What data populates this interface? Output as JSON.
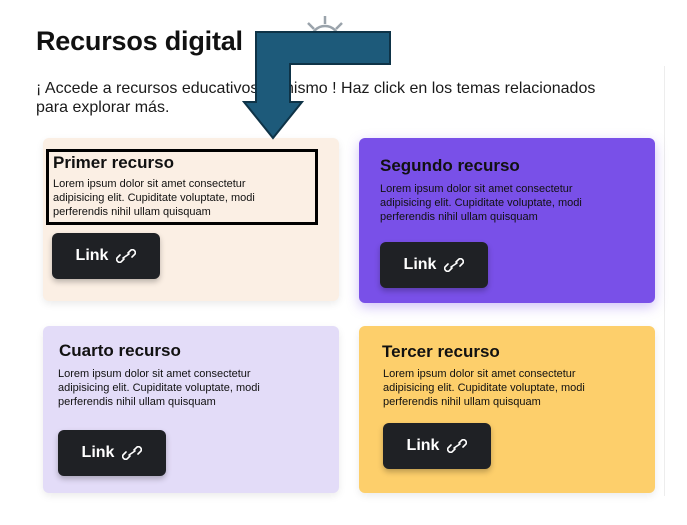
{
  "page": {
    "title": "Recursos digital",
    "intro": "¡ Accede a recursos educativos tú mismo ! Haz click en los temas relacionados para explorar más."
  },
  "cards": [
    {
      "title": "Primer recurso",
      "text": "Lorem ipsum dolor sit amet consectetur adipisicing elit. Cupiditate voluptate, modi perferendis nihil ullam quisquam",
      "link_label": "Link",
      "color": "#fbefe4"
    },
    {
      "title": "Segundo recurso",
      "text": "Lorem ipsum dolor sit amet consectetur adipisicing elit. Cupiditate voluptate, modi perferendis nihil ullam quisquam",
      "link_label": "Link",
      "color": "#7950e8"
    },
    {
      "title": "Cuarto recurso",
      "text": "Lorem ipsum dolor sit amet consectetur adipisicing elit. Cupiditate voluptate, modi perferendis nihil ullam quisquam",
      "link_label": "Link",
      "color": "#e3dcf8"
    },
    {
      "title": "Tercer recurso",
      "text": "Lorem ipsum dolor sit amet consectetur adipisicing elit. Cupiditate voluptate, modi perferendis nihil ullam quisquam",
      "link_label": "Link",
      "color": "#fdcf6b"
    }
  ],
  "overlay": {
    "arrow_color": "#1d5a7a",
    "highlight_color": "#000000",
    "icons": [
      "gear-icon",
      "link-icon"
    ]
  }
}
